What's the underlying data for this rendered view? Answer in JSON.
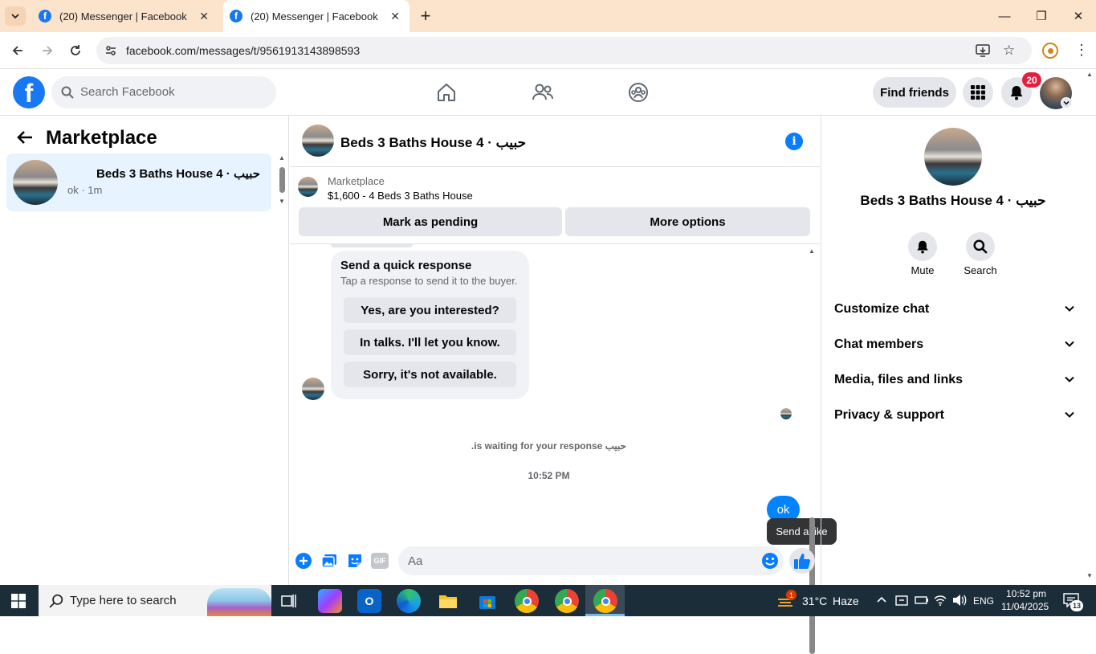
{
  "browser": {
    "tabs": [
      {
        "title": "(20) Messenger | Facebook",
        "active": false
      },
      {
        "title": "(20) Messenger | Facebook",
        "active": true
      }
    ],
    "url": "facebook.com/messages/t/9561913143898593"
  },
  "fb_header": {
    "logo": "f",
    "search_placeholder": "Search Facebook",
    "find_friends_label": "Find friends",
    "notification_count": "20"
  },
  "sidebar": {
    "title": "Marketplace",
    "conversation": {
      "name": "Beds 3 Baths House 4 · حبيب",
      "preview": "ok · 1m"
    }
  },
  "chat": {
    "header_name": "Beds 3 Baths House 4 · حبيب",
    "marketplace_label": "Marketplace",
    "listing": "$1,600 - 4 Beds 3 Baths House",
    "mark_pending_label": "Mark as pending",
    "more_options_label": "More options",
    "quick_response_title": "Send a quick response",
    "quick_response_subtitle": "Tap a response to send it to the buyer.",
    "quick_responses": [
      "Yes, are you interested?",
      "In talks. I'll let you know.",
      "Sorry, it's not available."
    ],
    "waiting_text": "حبيب is waiting for your response.",
    "timestamp": "10:52 PM",
    "sent_message": "ok",
    "tooltip": "Send a like",
    "composer_placeholder": "Aa",
    "gif_label": "GIF"
  },
  "details": {
    "name": "Beds 3 Baths House 4 · حبيب",
    "mute_label": "Mute",
    "search_label": "Search",
    "sections": [
      "Customize chat",
      "Chat members",
      "Media, files and links",
      "Privacy & support"
    ]
  },
  "taskbar": {
    "search_placeholder": "Type here to search",
    "weather_temp": "31°C",
    "weather_desc": "Haze",
    "weather_badge": "1",
    "language": "ENG",
    "time": "10:52 pm",
    "date": "11/04/2025",
    "notification_count": "13"
  },
  "colors": {
    "fb_blue": "#1877f2",
    "messenger_blue": "#0084ff",
    "tab_strip": "#fbe3cc",
    "badge_red": "#e41e3f",
    "taskbar": "#1c2d3a"
  }
}
